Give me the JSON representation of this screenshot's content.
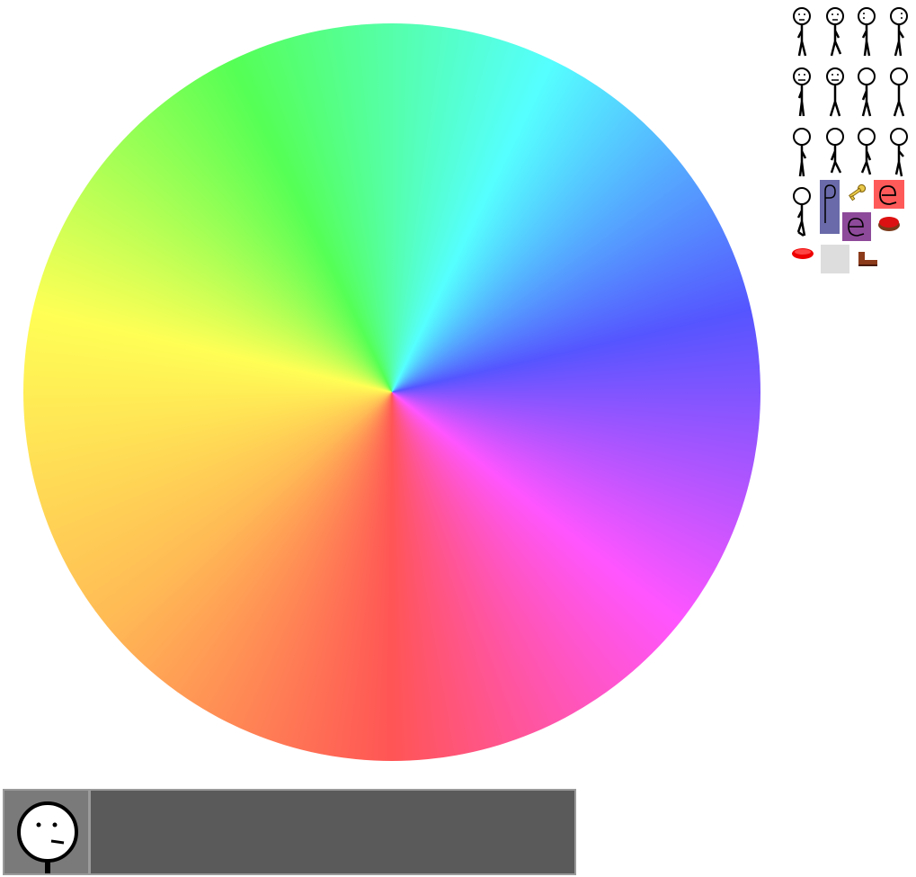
{
  "scene": {
    "wheel_colors": [
      "#ff5555",
      "#ffbb55",
      "#ffff55",
      "#55ff55",
      "#55ffff",
      "#5555ff",
      "#ff55ff",
      "#ff5555"
    ],
    "background": "#ffffff"
  },
  "sprite_sheet": {
    "stick_figures": [
      {
        "icon": "stick-figure-icon",
        "face": "left-look"
      },
      {
        "icon": "stick-figure-icon",
        "face": "left-look"
      },
      {
        "icon": "stick-figure-icon",
        "face": "dots"
      },
      {
        "icon": "stick-figure-icon",
        "face": "dots"
      },
      {
        "icon": "stick-figure-icon",
        "face": "neutral"
      },
      {
        "icon": "stick-figure-icon",
        "face": "neutral"
      },
      {
        "icon": "stick-figure-icon",
        "face": "blank"
      },
      {
        "icon": "stick-figure-icon",
        "face": "blank"
      },
      {
        "icon": "stick-figure-icon",
        "face": "blank"
      },
      {
        "icon": "stick-figure-icon",
        "face": "blank"
      },
      {
        "icon": "stick-figure-icon",
        "face": "blank"
      },
      {
        "icon": "stick-figure-icon",
        "face": "blank"
      },
      {
        "icon": "stick-figure-icon",
        "face": "blank"
      }
    ],
    "items": [
      {
        "icon": "door-p-icon",
        "letter": "p",
        "color": "#6a6aaa"
      },
      {
        "icon": "key-icon",
        "color": "#e8c84a"
      },
      {
        "icon": "door-e-red-icon",
        "letter": "e",
        "color": "#ff5a5a"
      },
      {
        "icon": "door-e-purple-icon",
        "letter": "e",
        "color": "#8e4a9a"
      },
      {
        "icon": "red-button-icon",
        "color": "#dd1111"
      },
      {
        "icon": "red-disc-icon",
        "color": "#ee0000"
      },
      {
        "icon": "gray-block-icon",
        "color": "#dddddd"
      },
      {
        "icon": "boot-icon",
        "color": "#8b3a1a"
      }
    ]
  },
  "dialog": {
    "text": "",
    "panel_color": "#5a5a5a",
    "portrait_icon": "stick-face-icon"
  }
}
